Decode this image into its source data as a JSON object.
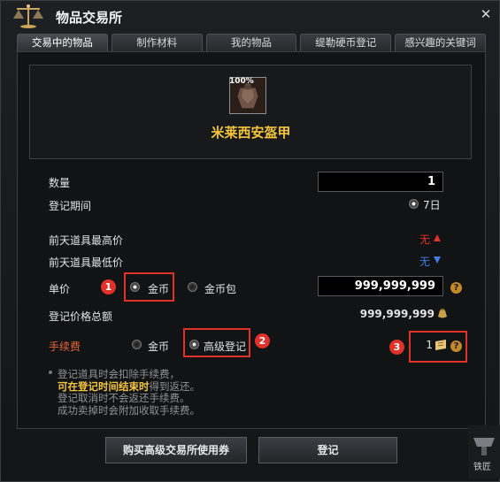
{
  "window": {
    "title": "物品交易所",
    "close_glyph": "✕"
  },
  "tabs": [
    {
      "label": "交易中的物品"
    },
    {
      "label": "制作材料"
    },
    {
      "label": "我的物品"
    },
    {
      "label": "缇勒硬币登记"
    },
    {
      "label": "感兴趣的关键词"
    }
  ],
  "item": {
    "durability": "100%",
    "name": "米莱西安盔甲",
    "icon": "armor-icon"
  },
  "form": {
    "quantity_label": "数量",
    "quantity_value": "1",
    "period_label": "登记期间",
    "period_value": "7日",
    "max_price_label": "前天道具最高价",
    "max_price_value": "无",
    "min_price_label": "前天道具最低价",
    "min_price_value": "无",
    "unit_price_label": "单价",
    "unit_price_opt1": "金币",
    "unit_price_opt2": "金币包",
    "unit_price_value": "999,999,999",
    "total_label": "登记价格总额",
    "total_value": "999,999,999",
    "fee_label": "手续费",
    "fee_opt1": "金币",
    "fee_opt2": "高级登记",
    "fee_value": "1"
  },
  "annotations": [
    "1",
    "2",
    "3"
  ],
  "notes": {
    "line1": "登记道具时会扣除手续费，",
    "line2_highlight": "可在登记时间结束时",
    "line2_rest": "得到返还。",
    "line3": "登记取消时不会返还手续费。",
    "line4": "成功卖掉时会附加收取手续费。"
  },
  "buttons": {
    "buy_ticket": "购买高级交易所使用券",
    "register": "登记"
  },
  "corner": {
    "label": "铁匠"
  },
  "colors": {
    "accent": "#f4c63d",
    "fee_label": "#e8663a",
    "up": "#e0322b",
    "down": "#3d7de0",
    "annotation": "#e0322b"
  }
}
